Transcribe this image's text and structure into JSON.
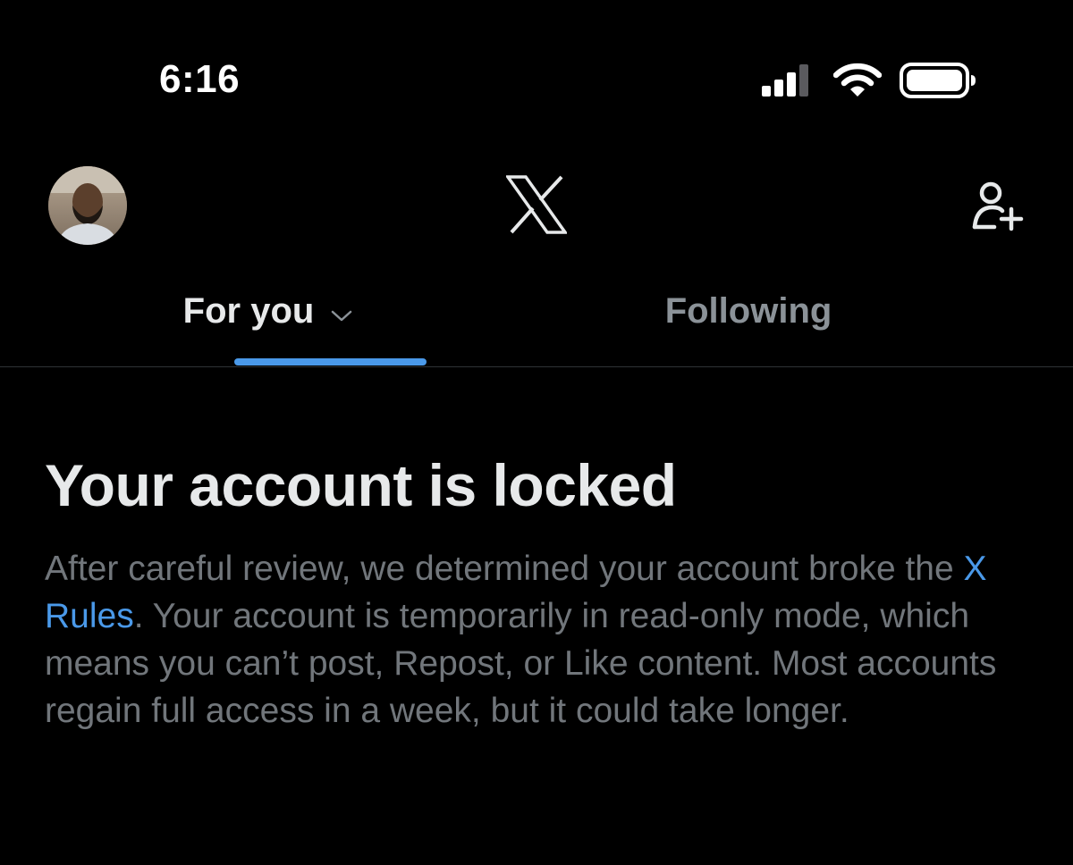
{
  "status_bar": {
    "time": "6:16",
    "icons": [
      "cellular-signal-icon",
      "wifi-icon",
      "battery-icon"
    ]
  },
  "top_nav": {
    "avatar_icon": "profile-avatar",
    "logo_icon": "x-logo-icon",
    "right_icon": "add-user-icon"
  },
  "tabs": [
    {
      "label": "For you",
      "selected": true,
      "has_dropdown": true
    },
    {
      "label": "Following",
      "selected": false
    }
  ],
  "notice": {
    "title": "Your account is locked",
    "body_prefix": "After careful review, we determined your account broke the ",
    "link_text": "X Rules",
    "body_suffix": ". Your account is temporarily in read-only mode, which means you can’t post, Repost, or Like content. Most accounts regain full access in a week, but it could take longer."
  },
  "colors": {
    "background": "#000000",
    "primary_text": "#e7e9ea",
    "secondary_text": "#71767b",
    "accent": "#4a99e9",
    "divider": "#2f3336"
  }
}
